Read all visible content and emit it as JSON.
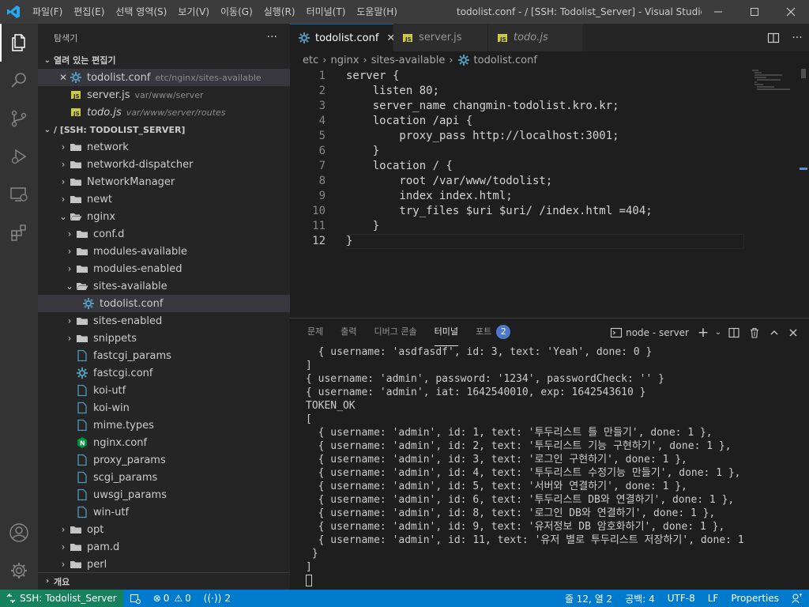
{
  "titlebar": {
    "menus": [
      "파일(F)",
      "편집(E)",
      "선택 영역(S)",
      "보기(V)",
      "이동(G)",
      "실행(R)",
      "터미널(T)",
      "도움말(H)"
    ],
    "window_title": "todolist.conf - / [SSH: Todolist_Server] - Visual Studio Co..."
  },
  "sidebar": {
    "title": "탐색기",
    "open_editors": {
      "header": "열려 있는 편집기",
      "items": [
        {
          "name": "todolist.conf",
          "path": "etc/nginx/sites-available"
        },
        {
          "name": "server.js",
          "path": "var/www/server"
        },
        {
          "name": "todo.js",
          "path": "var/www/server/routes"
        }
      ]
    },
    "workspace": {
      "header": "/ [SSH: TODOLIST_SERVER]",
      "items": [
        {
          "label": "network"
        },
        {
          "label": "networkd-dispatcher"
        },
        {
          "label": "NetworkManager"
        },
        {
          "label": "newt"
        },
        {
          "label": "nginx"
        },
        {
          "label": "conf.d"
        },
        {
          "label": "modules-available"
        },
        {
          "label": "modules-enabled"
        },
        {
          "label": "sites-available"
        },
        {
          "label": "todolist.conf"
        },
        {
          "label": "sites-enabled"
        },
        {
          "label": "snippets"
        },
        {
          "label": "fastcgi_params"
        },
        {
          "label": "fastcgi.conf"
        },
        {
          "label": "koi-utf"
        },
        {
          "label": "koi-win"
        },
        {
          "label": "mime.types"
        },
        {
          "label": "nginx.conf"
        },
        {
          "label": "proxy_params"
        },
        {
          "label": "scgi_params"
        },
        {
          "label": "uwsgi_params"
        },
        {
          "label": "win-utf"
        },
        {
          "label": "opt"
        },
        {
          "label": "pam.d"
        },
        {
          "label": "perl"
        }
      ]
    },
    "outline_header": "개요"
  },
  "tabs": [
    {
      "label": "todolist.conf"
    },
    {
      "label": "server.js"
    },
    {
      "label": "todo.js"
    }
  ],
  "breadcrumb": [
    "etc",
    "nginx",
    "sites-available",
    "todolist.conf"
  ],
  "code": {
    "line_numbers": [
      "1",
      "2",
      "3",
      "4",
      "5",
      "6",
      "7",
      "8",
      "9",
      "10",
      "11",
      "12"
    ],
    "lines": [
      "server {",
      "    listen 80;",
      "    server_name changmin-todolist.kro.kr;",
      "    location /api {",
      "        proxy_pass http://localhost:3001;",
      "    }",
      "    location / {",
      "        root /var/www/todolist;",
      "        index index.html;",
      "        try_files $uri $uri/ /index.html =404;",
      "    }",
      "}"
    ]
  },
  "panel": {
    "tabs": [
      "문제",
      "출력",
      "디버그 콘솔",
      "터미널",
      "포트"
    ],
    "ports_badge": "2",
    "terminal_name": "node - server",
    "terminal_lines": [
      "  { username: 'asdfasdf', id: 3, text: 'Yeah', done: 0 }",
      "]",
      "{ username: 'admin', password: '1234', passwordCheck: '' }",
      "{ username: 'admin', iat: 1642540010, exp: 1642543610 }",
      "TOKEN_OK",
      "[",
      "  { username: 'admin', id: 1, text: '투두리스트 틀 만들기', done: 1 },",
      "  { username: 'admin', id: 2, text: '투두리스트 기능 구현하기', done: 1 },",
      "  { username: 'admin', id: 3, text: '로그인 구현하기', done: 1 },",
      "  { username: 'admin', id: 4, text: '투두리스트 수정기능 만들기', done: 1 },",
      "  { username: 'admin', id: 5, text: '서버와 연결하기', done: 1 },",
      "  { username: 'admin', id: 6, text: '투두리스트 DB와 연결하기', done: 1 },",
      "  { username: 'admin', id: 8, text: '로그인 DB와 연결하기', done: 1 },",
      "  { username: 'admin', id: 9, text: '유저정보 DB 암호화하기', done: 1 },",
      "  { username: 'admin', id: 11, text: '유저 별로 투두리스트 저장하기', done: 1",
      " }",
      "]"
    ]
  },
  "statusbar": {
    "remote": "SSH: Todolist_Server",
    "errors": "0",
    "warnings": "0",
    "ports": "2",
    "position": "줄 12, 열 2",
    "spaces": "공백: 4",
    "encoding": "UTF-8",
    "eol": "LF",
    "language": "Properties"
  },
  "colors": {
    "accent": "#007acc",
    "remote": "#16825d",
    "sidebar_bg": "#252526",
    "editor_bg": "#1e1e1e"
  }
}
